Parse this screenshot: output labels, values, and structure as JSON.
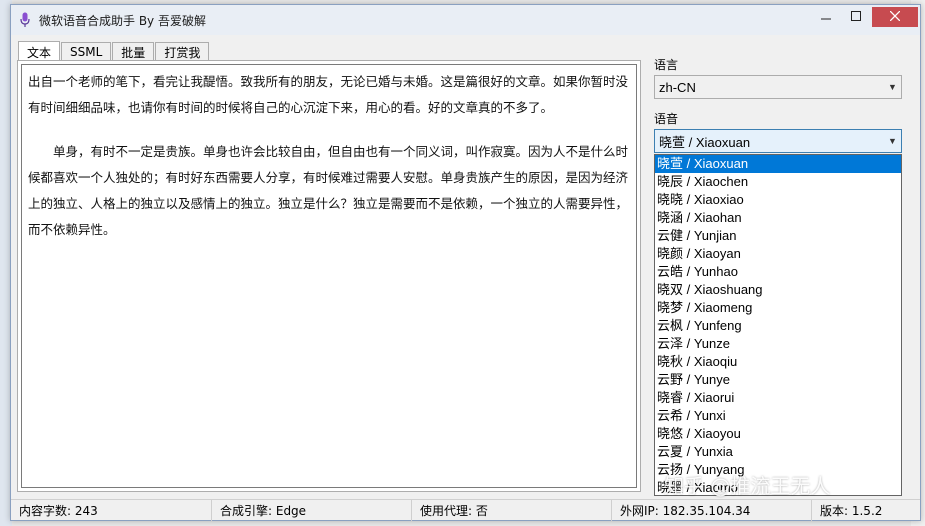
{
  "window": {
    "title": "微软语音合成助手 By 吾爱破解",
    "minimize_icon": "minimize-icon",
    "maximize_icon": "maximize-icon",
    "close_icon": "close-icon",
    "close_color": "#c74b50"
  },
  "tabs": [
    {
      "label": "文本",
      "active": true
    },
    {
      "label": "SSML",
      "active": false
    },
    {
      "label": "批量",
      "active": false
    },
    {
      "label": "打赏我",
      "active": false
    }
  ],
  "editor": {
    "paragraph1": "出自一个老师的笔下，看完让我醍悟。致我所有的朋友，无论已婚与未婚。这是篇很好的文章。如果你暂时没有时间细细品味，也请你有时间的时候将自己的心沉淀下来，用心的看。好的文章真的不多了。",
    "paragraph2": "单身，有时不一定是贵族。单身也许会比较自由，但自由也有一个同义词，叫作寂寞。因为人不是什么时候都喜欢一个人独处的；有时好东西需要人分享，有时候难过需要人安慰。单身贵族产生的原因，是因为经济上的独立、人格上的独立以及感情上的独立。独立是什么？独立是需要而不是依赖，一个独立的人需要异性，而不依赖异性。"
  },
  "language": {
    "label": "语言",
    "value": "zh-CN"
  },
  "voice": {
    "label": "语音",
    "value": "晓萱 / Xiaoxuan",
    "selected_color": "#0078d7",
    "options": [
      "晓萱 / Xiaoxuan",
      "晓辰 / Xiaochen",
      "晓晓 / Xiaoxiao",
      "晓涵 / Xiaohan",
      "云健 / Yunjian",
      "晓颜 / Xiaoyan",
      "云皓 / Yunhao",
      "晓双 / Xiaoshuang",
      "晓梦 / Xiaomeng",
      "云枫 / Yunfeng",
      "云泽 / Yunze",
      "晓秋 / Xiaoqiu",
      "云野 / Yunye",
      "晓睿 / Xiaorui",
      "云希 / Yunxi",
      "晓悠 / Xiaoyou",
      "云夏 / Yunxia",
      "云扬 / Yunyang",
      "晓墨 / Xiaomo"
    ]
  },
  "status": {
    "char_count": "内容字数: 243",
    "engine": "合成引擎: Edge",
    "proxy": "使用代理: 否",
    "ip": "外网IP: 182.35.104.34",
    "version": "版本: 1.5.2"
  },
  "watermark": "知乎 @推流王无人"
}
